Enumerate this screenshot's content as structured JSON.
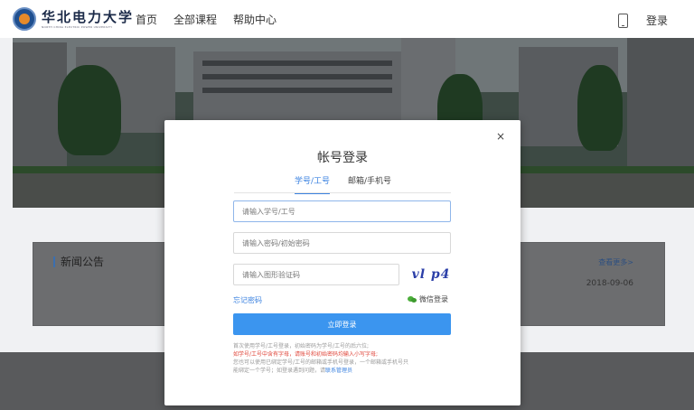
{
  "header": {
    "logo_name": "华北电力大学",
    "logo_subtitle": "NORTH CHINA ELECTRIC POWER UNIVERSITY",
    "nav": [
      "首页",
      "全部课程",
      "帮助中心"
    ],
    "login_label": "登录"
  },
  "news": {
    "title": "新闻公告",
    "more_label": "查看更多>",
    "date": "2018-09-06"
  },
  "modal": {
    "close_label": "×",
    "title": "帐号登录",
    "tabs": [
      "学号/工号",
      "邮箱/手机号"
    ],
    "id_placeholder": "请输入学号/工号",
    "password_placeholder": "请输入密码/初始密码",
    "captcha_placeholder": "请输入图形验证码",
    "captcha_text": "vl p4",
    "forgot_label": "忘记密码",
    "wechat_label": "微信登录",
    "submit_label": "立即登录",
    "note_line1": "首次使用学号/工号登录，初始密码为学号/工号的后六位;",
    "note_line2_red": "如学号/工号中含有字母，请账号和初始密码均输入小写字母;",
    "note_line3": "您也可以使用已绑定学号/工号的邮箱或手机号登录，一个邮箱或手机号只",
    "note_line4_prefix": "能绑定一个学号；如登录遇到问题，请",
    "note_line4_link": "联系管理员"
  },
  "colors": {
    "accent": "#3b82e0",
    "button": "#3b95ef",
    "warning": "#e0453a",
    "wechat": "#4cae3b"
  }
}
